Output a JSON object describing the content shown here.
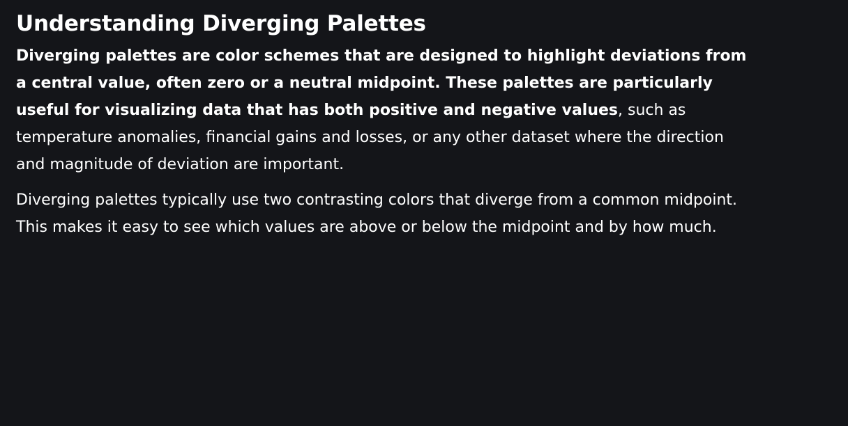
{
  "document": {
    "title": "Understanding Diverging Palettes",
    "paragraph1": {
      "bold_text": "Diverging palettes are color schemes that are designed to highlight deviations from a central value, often zero or a neutral midpoint. These palettes are particularly useful for visualizing data that has both positive and negative values",
      "rest_text": ", such as temperature anomalies, financial gains and losses, or any other dataset where the direction and magnitude of deviation are important."
    },
    "paragraph2": {
      "text": "Diverging palettes typically use two contrasting colors that diverge from a common midpoint. This makes it easy to see which values are above or below the midpoint and by how much."
    }
  },
  "colors": {
    "background": "#141519",
    "text": "#ffffff"
  }
}
